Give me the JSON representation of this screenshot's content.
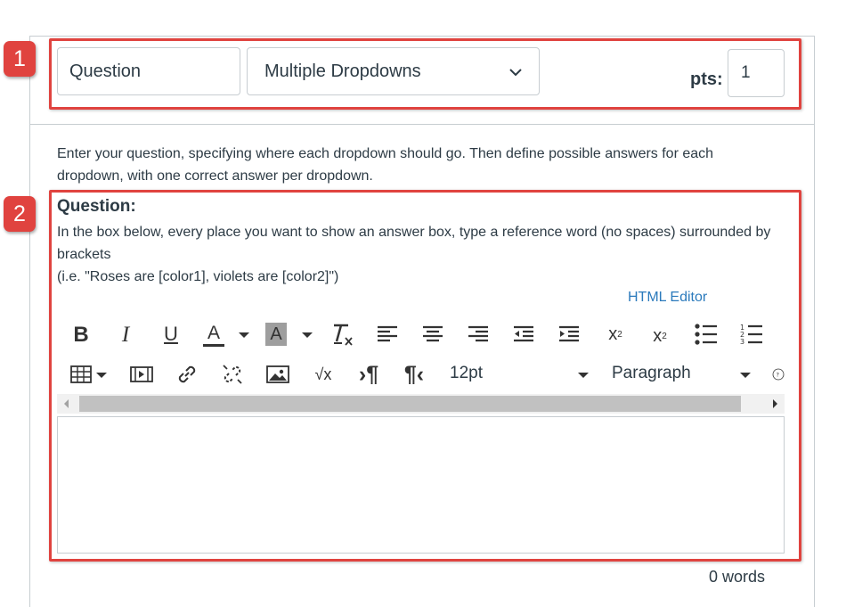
{
  "badges": {
    "one": "1",
    "two": "2"
  },
  "question_header": {
    "name_value": "Question",
    "type_value": "Multiple Dropdowns",
    "pts_label": "pts:",
    "pts_value": "1"
  },
  "intro_text": "Enter your question, specifying where each dropdown should go. Then define possible answers for each dropdown, with one correct answer per dropdown.",
  "question_label": "Question:",
  "instructions": {
    "line1": "In the box below, every place you want to show an answer box, type a reference word (no spaces) surrounded by brackets",
    "line2": "(i.e. \"Roses are [color1], violets are [color2]\")"
  },
  "html_editor_link": "HTML Editor",
  "toolbar": {
    "font_size": "12pt",
    "block_format": "Paragraph",
    "superscript_mark": "2",
    "subscript_mark": "2"
  },
  "word_count": "0 words",
  "colors": {
    "highlight": "#e0433f",
    "link": "#2b7abc",
    "text": "#2d3b45"
  }
}
